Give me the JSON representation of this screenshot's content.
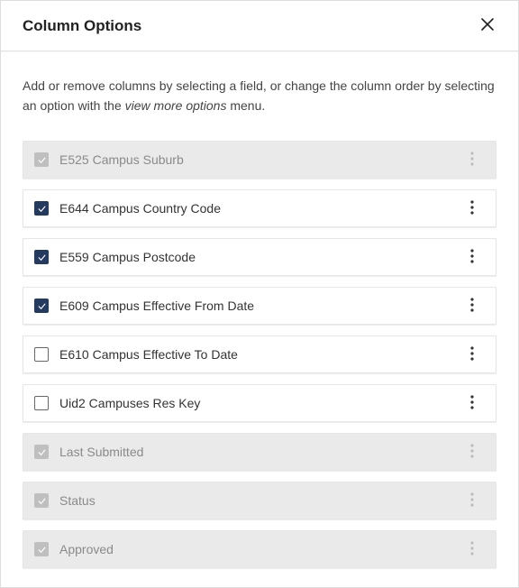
{
  "dialog": {
    "title": "Column Options",
    "description_prefix": "Add or remove columns by selecting a field, or change the column order by selecting an option with the ",
    "description_emphasis": "view more options",
    "description_suffix": " menu."
  },
  "columns": [
    {
      "label": "E525 Campus Suburb",
      "checked": true,
      "locked": true
    },
    {
      "label": "E644 Campus Country Code",
      "checked": true,
      "locked": false
    },
    {
      "label": "E559 Campus Postcode",
      "checked": true,
      "locked": false
    },
    {
      "label": "E609 Campus Effective From Date",
      "checked": true,
      "locked": false
    },
    {
      "label": "E610 Campus Effective To Date",
      "checked": false,
      "locked": false
    },
    {
      "label": "Uid2 Campuses Res Key",
      "checked": false,
      "locked": false
    },
    {
      "label": "Last Submitted",
      "checked": true,
      "locked": true
    },
    {
      "label": "Status",
      "checked": true,
      "locked": true
    },
    {
      "label": "Approved",
      "checked": true,
      "locked": true
    }
  ]
}
